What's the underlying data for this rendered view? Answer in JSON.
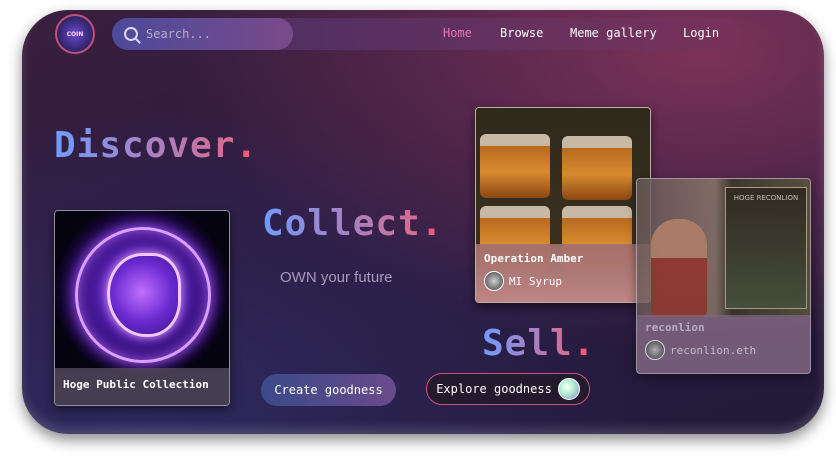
{
  "brand": {
    "logo_text": "COIN"
  },
  "search": {
    "placeholder": "Search..."
  },
  "nav": {
    "items": [
      {
        "label": "Home",
        "active": true
      },
      {
        "label": "Browse",
        "active": false
      },
      {
        "label": "Meme gallery",
        "active": false
      },
      {
        "label": "Login",
        "active": false
      }
    ]
  },
  "hero": {
    "discover": "Discover",
    "collect": "Collect",
    "sell": "Sell",
    "dot": ".",
    "tagline": "OWN your future"
  },
  "cards": [
    {
      "title": "Hoge Public Collection"
    },
    {
      "title": "Operation Amber",
      "creator": "MI Syrup"
    },
    {
      "title": "reconlion",
      "creator": "reconlion.eth",
      "poster_text": "HOGE RECONLION"
    }
  ],
  "buttons": {
    "create": "Create goodness",
    "explore": "Explore goodness"
  },
  "colors": {
    "accent_pink": "#ef5a79",
    "accent_blue": "#6f9cff",
    "active_nav": "#e57ab3"
  }
}
